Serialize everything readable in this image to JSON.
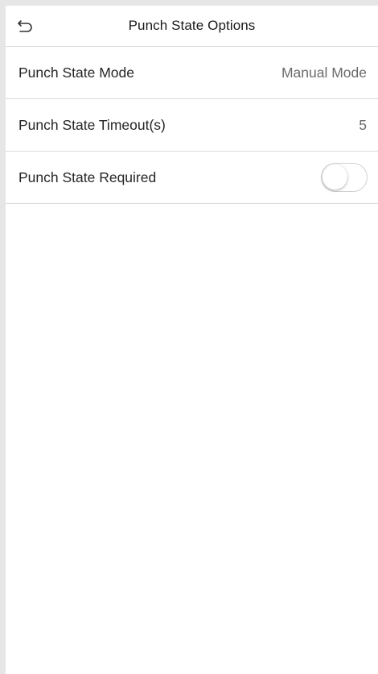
{
  "header": {
    "title": "Punch State Options",
    "back_icon": "back-arrow-icon"
  },
  "settings": [
    {
      "label": "Punch State Mode",
      "value": "Manual Mode"
    },
    {
      "label": "Punch State Timeout(s)",
      "value": "5"
    },
    {
      "label": "Punch State Required",
      "toggle_on": false
    }
  ],
  "colors": {
    "background": "#ffffff",
    "divider": "#d9d9d9",
    "value_text": "#6b6b6b",
    "toggle_border": "#d0d0d0"
  }
}
